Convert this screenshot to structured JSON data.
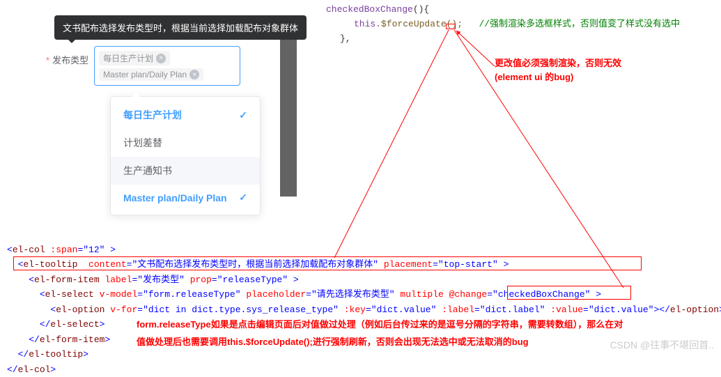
{
  "tooltip": {
    "content": "文书配布选择发布类型时，根据当前选择加载配布对象群体"
  },
  "form": {
    "label": "发布类型",
    "tags": [
      {
        "text": "每日生产计划"
      },
      {
        "text": "Master plan/Daily Plan"
      }
    ]
  },
  "dropdown": {
    "items": [
      {
        "label": "每日生产计划",
        "selected": true
      },
      {
        "label": "计划差替",
        "selected": false
      },
      {
        "label": "生产通知书",
        "selected": false,
        "hover": true
      },
      {
        "label": "Master plan/Daily Plan",
        "selected": true
      }
    ]
  },
  "code_top": {
    "line1_fn": "checkedBoxChange",
    "line1_rest": "(){",
    "line2_this": "this",
    "line2_call": ".$forceUpdate();",
    "line2_comment": "//强制渲染多选框样式，否则值变了样式没有选中",
    "line3": "},"
  },
  "red_notes": {
    "n1": "更改值必须强制渲染，否则无效",
    "n2": "(element ui 的bug)",
    "n3": "form.releaseType如果是点击编辑页面后对值做过处理（例如后台传过来的是逗号分隔的字符串，需要转数组），那么在对",
    "n4": "值做处理后也需要调用this.$forceUpdate();进行强制刷新，否则会出现无法选中或无法取消的bug"
  },
  "code_bottom": {
    "l1": {
      "tag": "el-col",
      "attrs": [
        [
          " :span",
          "12"
        ]
      ]
    },
    "l2": {
      "tag": "el-tooltip",
      "attrs": [
        [
          "  content",
          "文书配布选择发布类型时，根据当前选择加载配布对象群体"
        ],
        [
          " placement",
          "top-start"
        ]
      ]
    },
    "l3": {
      "tag": "el-form-item",
      "attrs": [
        [
          " label",
          "发布类型"
        ],
        [
          " prop",
          "releaseType"
        ]
      ]
    },
    "l4": {
      "tag": "el-select",
      "attrs": [
        [
          " v-model",
          "form.releaseType"
        ],
        [
          " placeholder",
          "请先选择发布类型"
        ]
      ],
      "flag": "multiple",
      "attrs2": [
        [
          " @change",
          "checkedBoxChange"
        ]
      ]
    },
    "l5": {
      "tag": "el-option",
      "attrs": [
        [
          " v-for",
          "dict in dict.type.sys_release_type"
        ],
        [
          " :key",
          "dict.value"
        ],
        [
          " :label",
          "dict.label"
        ],
        [
          " :value",
          "dict.value"
        ]
      ]
    },
    "c6": "el-select",
    "c7": "el-form-item",
    "c8": "el-tooltip",
    "c9": "el-col"
  },
  "watermark": "CSDN @往事不堪回首.."
}
